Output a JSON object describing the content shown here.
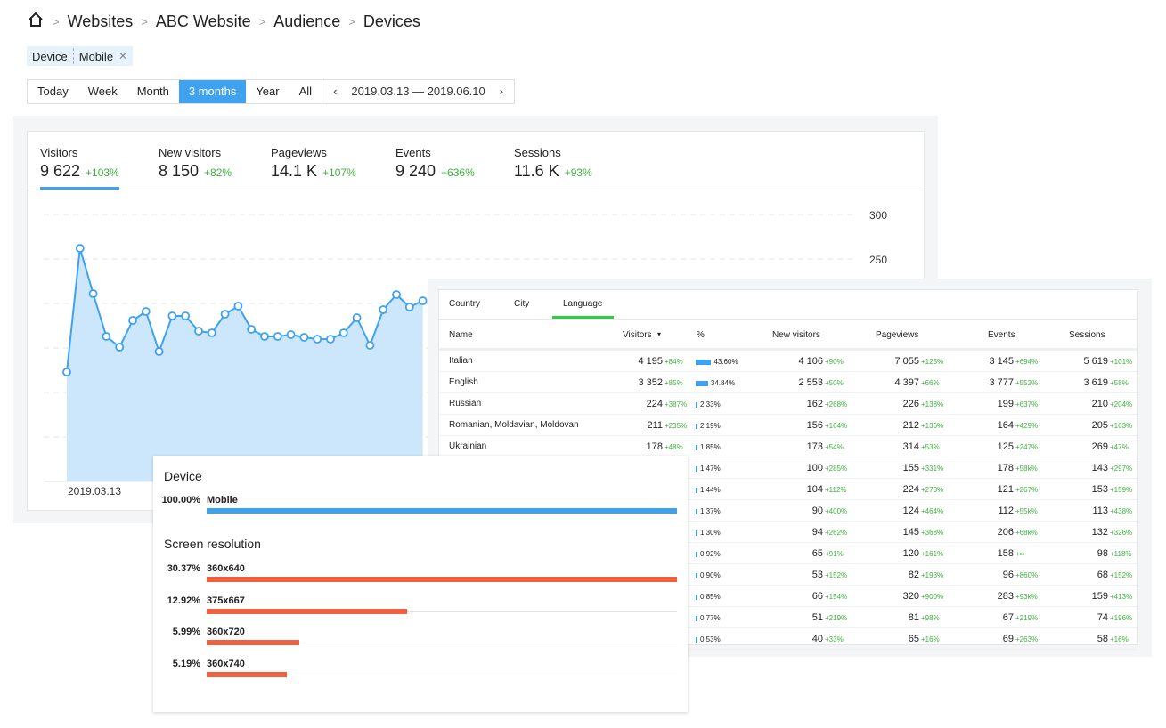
{
  "breadcrumb": [
    "Websites",
    "ABC Website",
    "Audience",
    "Devices"
  ],
  "filter": {
    "key": "Device",
    "value": "Mobile"
  },
  "periods": [
    "Today",
    "Week",
    "Month",
    "3 months",
    "Year",
    "All"
  ],
  "active_period": "3 months",
  "date_range": "2019.03.13 — 2019.06.10",
  "metrics": [
    {
      "label": "Visitors",
      "value": "9 622",
      "delta": "+103%"
    },
    {
      "label": "New visitors",
      "value": "8 150",
      "delta": "+82%"
    },
    {
      "label": "Pageviews",
      "value": "14.1 K",
      "delta": "+107%"
    },
    {
      "label": "Events",
      "value": "9 240",
      "delta": "+636%"
    },
    {
      "label": "Sessions",
      "value": "11.6 K",
      "delta": "+93%"
    }
  ],
  "colors": {
    "accent": "#3ea2f1",
    "positive": "#3cb33c",
    "resolution_bar": "#f0623f",
    "tab_underline": "#2ecc40"
  },
  "chart_data": {
    "type": "area",
    "series": [
      {
        "values": [
          123,
          262,
          211,
          163,
          151,
          181,
          191,
          146,
          186,
          186,
          169,
          167,
          188,
          197,
          171,
          163,
          163,
          165,
          162,
          160,
          160,
          167,
          184,
          153,
          193,
          210,
          196,
          203
        ]
      }
    ],
    "x_tick_labels": [
      "2019.03.13"
    ],
    "y_tick_labels": [
      "300",
      "250"
    ],
    "ylim": [
      0,
      300
    ],
    "grid": true
  },
  "table": {
    "tabs": [
      "Country",
      "City",
      "Language"
    ],
    "active_tab": "Language",
    "headers": [
      "Name",
      "Visitors",
      "%",
      "New visitors",
      "Pageviews",
      "Events",
      "Sessions"
    ],
    "sort_icon": "caret-down-icon",
    "rows": [
      [
        "Italian",
        "4 195",
        "+84%",
        "43.60%",
        "4 106",
        "+90%",
        "7 055",
        "+125%",
        "3 145",
        "+694%",
        "5 619",
        "+101%"
      ],
      [
        "English",
        "3 352",
        "+85%",
        "34.84%",
        "2 553",
        "+50%",
        "4 397",
        "+66%",
        "3 777",
        "+552%",
        "3 619",
        "+58%"
      ],
      [
        "Russian",
        "224",
        "+387%",
        "2.33%",
        "162",
        "+268%",
        "226",
        "+138%",
        "199",
        "+637%",
        "210",
        "+204%"
      ],
      [
        "Romanian, Moldavian, Moldovan",
        "211",
        "+235%",
        "2.19%",
        "156",
        "+164%",
        "212",
        "+136%",
        "164",
        "+429%",
        "205",
        "+163%"
      ],
      [
        "Ukrainian",
        "178",
        "+48%",
        "1.85%",
        "173",
        "+54%",
        "314",
        "+53%",
        "125",
        "+247%",
        "269",
        "+47%"
      ],
      [
        "",
        "",
        "",
        "1.47%",
        "100",
        "+285%",
        "155",
        "+331%",
        "178",
        "+58k%",
        "143",
        "+297%"
      ],
      [
        "",
        "",
        "",
        "1.44%",
        "104",
        "+112%",
        "224",
        "+273%",
        "121",
        "+267%",
        "153",
        "+159%"
      ],
      [
        "",
        "",
        "",
        "1.37%",
        "90",
        "+400%",
        "124",
        "+464%",
        "112",
        "+55k%",
        "113",
        "+438%"
      ],
      [
        "",
        "",
        "",
        "1.30%",
        "94",
        "+262%",
        "145",
        "+368%",
        "206",
        "+68k%",
        "132",
        "+326%"
      ],
      [
        "",
        "",
        "",
        "0.92%",
        "65",
        "+91%",
        "120",
        "+161%",
        "158",
        "+∞",
        "98",
        "+118%"
      ],
      [
        "",
        "",
        "",
        "0.90%",
        "53",
        "+152%",
        "82",
        "+193%",
        "96",
        "+860%",
        "68",
        "+152%"
      ],
      [
        "",
        "",
        "",
        "0.85%",
        "66",
        "+154%",
        "320",
        "+900%",
        "283",
        "+93k%",
        "159",
        "+413%"
      ],
      [
        "",
        "",
        "",
        "0.77%",
        "51",
        "+219%",
        "81",
        "+98%",
        "67",
        "+219%",
        "74",
        "+196%"
      ],
      [
        "",
        "",
        "",
        "0.53%",
        "40",
        "+33%",
        "65",
        "+16%",
        "69",
        "+263%",
        "58",
        "+16%"
      ]
    ]
  },
  "device": {
    "title": "Device",
    "items": [
      {
        "pct": "100.00%",
        "name": "Mobile",
        "value": 100
      }
    ]
  },
  "resolution": {
    "title": "Screen resolution",
    "items": [
      {
        "pct": "30.37%",
        "name": "360x640",
        "value": 30.37
      },
      {
        "pct": "12.92%",
        "name": "375x667",
        "value": 12.92
      },
      {
        "pct": "5.99%",
        "name": "360x720",
        "value": 5.99
      },
      {
        "pct": "5.19%",
        "name": "360x740",
        "value": 5.19
      }
    ]
  }
}
